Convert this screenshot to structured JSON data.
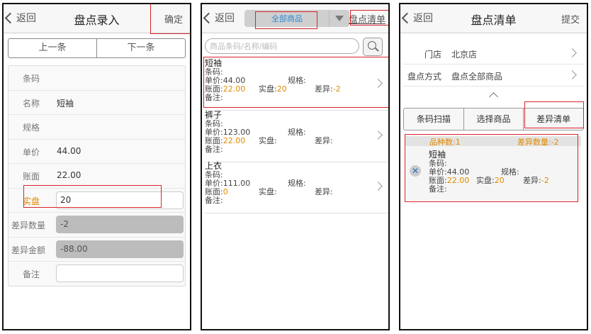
{
  "screen1": {
    "back": "返回",
    "title": "盘点录入",
    "confirm": "确定",
    "prev": "上一条",
    "next": "下一条",
    "fields": {
      "barcode": {
        "label": "条码",
        "value": ""
      },
      "name": {
        "label": "名称",
        "value": "短袖"
      },
      "spec": {
        "label": "规格",
        "value": ""
      },
      "price": {
        "label": "单价",
        "value": "44.00"
      },
      "book": {
        "label": "账面",
        "value": "22.00"
      },
      "actual": {
        "label": "实盘",
        "value": "20"
      },
      "diff_qty": {
        "label": "差异数量",
        "value": "-2"
      },
      "diff_amt": {
        "label": "差异金额",
        "value": "-88.00"
      },
      "remark": {
        "label": "备注",
        "value": ""
      }
    }
  },
  "screen2": {
    "back": "返回",
    "dropdown": "全部商品",
    "right": "盘点清单",
    "search_placeholder": "商品条码/名称/编码",
    "items": [
      {
        "name": "短袖",
        "barcode": "条码:",
        "price": "单价:44.00",
        "spec": "规格:",
        "book_label": "账面:",
        "book_value": "22.00",
        "actual_label": "实盘:",
        "actual_value": "20",
        "diff_label": "差异:",
        "diff_value": "-2",
        "remark": "备注:"
      },
      {
        "name": "裤子",
        "barcode": "条码:",
        "price": "单价:123.00",
        "spec": "规格:",
        "book_label": "账面:",
        "book_value": "22.00",
        "actual_label": "实盘:",
        "actual_value": "",
        "diff_label": "差异:",
        "diff_value": "",
        "remark": "备注:"
      },
      {
        "name": "上衣",
        "barcode": "条码:",
        "price": "单价:111.00",
        "spec": "规格:",
        "book_label": "账面:",
        "book_value": "0",
        "actual_label": "实盘:",
        "actual_value": "",
        "diff_label": "差异:",
        "diff_value": "",
        "remark": "备注:"
      }
    ]
  },
  "screen3": {
    "back": "返回",
    "title": "盘点清单",
    "submit": "提交",
    "store_label": "门店",
    "store_value": "北京店",
    "method_label": "盘点方式",
    "method_value": "盘点全部商品",
    "btn_scan": "条码扫描",
    "btn_select": "选择商品",
    "btn_diff": "差异清单",
    "sku_count": "品种数:1",
    "diff_count": "差异数量:-2",
    "item": {
      "name": "短袖",
      "barcode": "条码:",
      "price": "单价:44.00",
      "spec": "规格:",
      "book_label": "账面:",
      "book_value": "22.00",
      "actual_label": "实盘:",
      "actual_value": "20",
      "diff_label": "差异:",
      "diff_value": "-2",
      "remark": "备注:",
      "delete_icon": "✕"
    }
  },
  "colors": {
    "highlight": "#d9232d",
    "accent_orange": "#e08a00",
    "link_blue": "#2a8ad6"
  }
}
